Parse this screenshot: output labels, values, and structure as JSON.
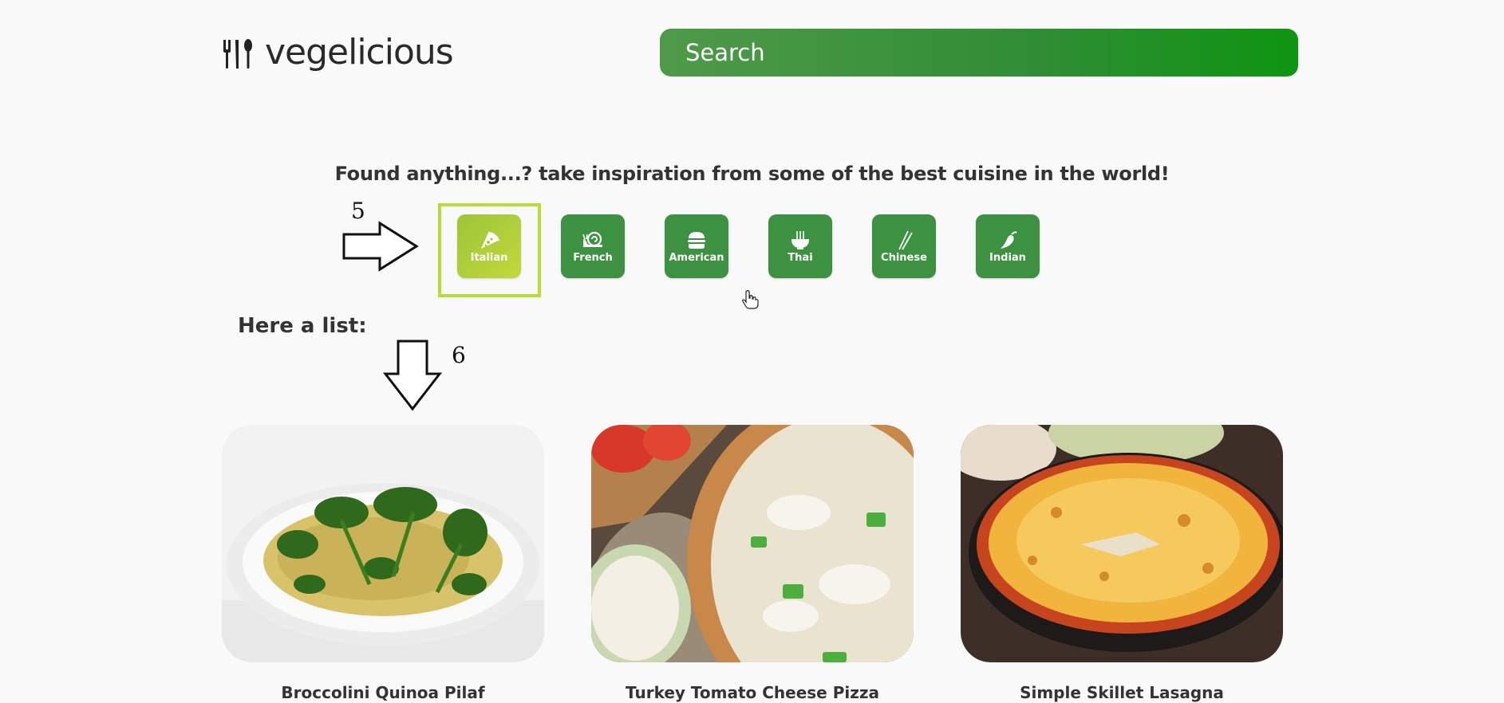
{
  "brand": {
    "name": "vegelicious",
    "icon": "fork-spoon-icon"
  },
  "search": {
    "placeholder": "Search"
  },
  "inspiration": {
    "text": "Found anything...? take inspiration from some of the best cuisine in the world!"
  },
  "annotations": {
    "step5": "5",
    "step6": "6"
  },
  "cuisines": [
    {
      "label": "Italian",
      "icon": "pizza-icon",
      "active": true
    },
    {
      "label": "French",
      "icon": "snail-icon",
      "active": false
    },
    {
      "label": "American",
      "icon": "burger-icon",
      "active": false
    },
    {
      "label": "Thai",
      "icon": "noodle-bowl-icon",
      "active": false
    },
    {
      "label": "Chinese",
      "icon": "chopsticks-icon",
      "active": false
    },
    {
      "label": "Indian",
      "icon": "chili-icon",
      "active": false
    }
  ],
  "list": {
    "heading": "Here a list:"
  },
  "recipes": [
    {
      "title": "Broccolini Quinoa Pilaf",
      "image": "quinoa-pilaf-photo"
    },
    {
      "title": "Turkey Tomato Cheese Pizza",
      "image": "pizza-photo"
    },
    {
      "title": "Simple Skillet Lasagna",
      "image": "lasagna-photo"
    }
  ],
  "colors": {
    "brand_green": "#3c9241",
    "active_lime": "#b9dc36",
    "background": "#f9f9f9"
  }
}
